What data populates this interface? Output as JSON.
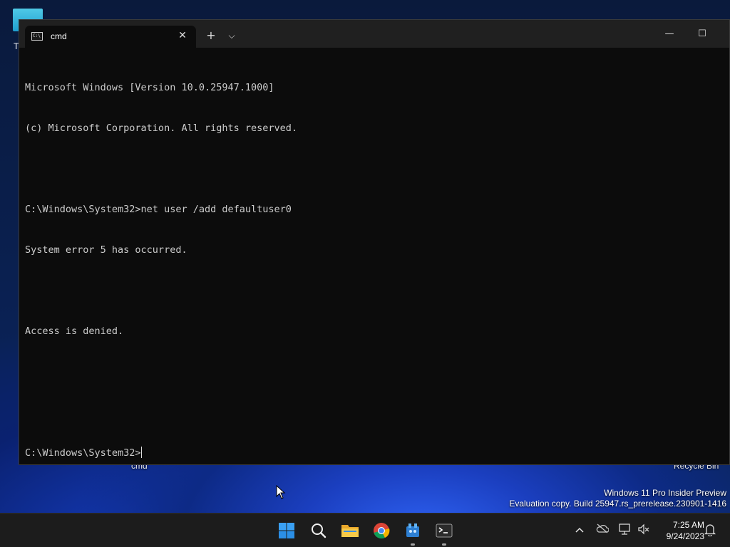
{
  "desktop": {
    "partial_icon_letter": "T",
    "label_cmd": "cmd",
    "label_recycle_bin": "Recycle Bin"
  },
  "window": {
    "tab_title": "cmd",
    "tab_close_glyph": "✕",
    "new_tab_glyph": "+",
    "dropdown_glyph": "⌵",
    "minimize_glyph": "—",
    "maximize_glyph": "☐",
    "console_lines": [
      "Microsoft Windows [Version 10.0.25947.1000]",
      "(c) Microsoft Corporation. All rights reserved.",
      "",
      "C:\\Windows\\System32>net user /add defaultuser0",
      "System error 5 has occurred.",
      "",
      "Access is denied.",
      "",
      "",
      "C:\\Windows\\System32>"
    ]
  },
  "watermark": {
    "line1": "Windows 11 Pro Insider Preview",
    "line2": "Evaluation copy. Build 25947.rs_prerelease.230901-1416"
  },
  "taskbar": {
    "apps": [
      {
        "name": "start-icon"
      },
      {
        "name": "search-icon"
      },
      {
        "name": "file-explorer-icon"
      },
      {
        "name": "chrome-icon"
      },
      {
        "name": "app-icon"
      },
      {
        "name": "terminal-icon"
      }
    ],
    "tray": {
      "chevron_glyph": "^",
      "time": "7:25 AM",
      "date": "9/24/2023"
    }
  },
  "colors": {
    "console_bg": "#0c0c0c",
    "console_fg": "#cccccc",
    "titlebar_bg": "#202020",
    "taskbar_bg": "#1c1c1c"
  }
}
